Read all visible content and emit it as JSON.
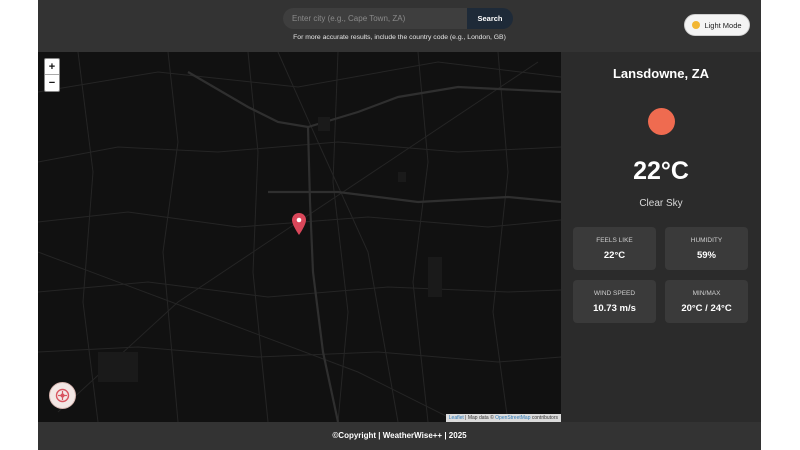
{
  "search": {
    "placeholder": "Enter city (e.g., Cape Town, ZA)",
    "button_label": "Search",
    "hint": "For more accurate results, include the country code (e.g., London, GB)"
  },
  "theme_toggle": {
    "label": "Light Mode",
    "icon": "sun-icon"
  },
  "map": {
    "zoom_in": "+",
    "zoom_out": "−",
    "attribution": {
      "leaflet": "Leaflet",
      "sep": " | Map data © ",
      "osm": "OpenStreetMap",
      "suffix": " contributors"
    }
  },
  "weather": {
    "location": "Lansdowne, ZA",
    "temperature": "22°C",
    "description": "Clear Sky",
    "icon_color": "#ef6b50",
    "stats": [
      {
        "label": "FEELS LIKE",
        "value": "22°C"
      },
      {
        "label": "HUMIDITY",
        "value": "59%"
      },
      {
        "label": "WIND SPEED",
        "value": "10.73 m/s"
      },
      {
        "label": "MIN/MAX",
        "value": "20°C / 24°C"
      }
    ]
  },
  "footer": {
    "text": "©Copyright | WeatherWise++ |  2025"
  }
}
